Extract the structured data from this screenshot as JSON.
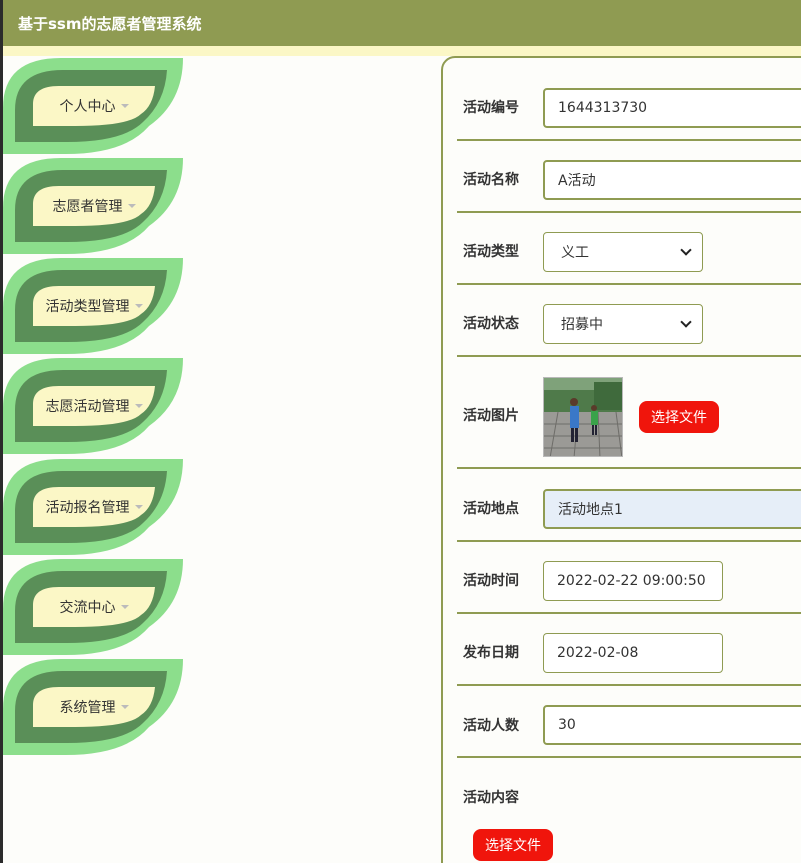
{
  "header": {
    "title": "基于ssm的志愿者管理系统"
  },
  "sidebar": {
    "items": [
      {
        "label": "个人中心"
      },
      {
        "label": "志愿者管理"
      },
      {
        "label": "活动类型管理"
      },
      {
        "label": "志愿活动管理"
      },
      {
        "label": "活动报名管理"
      },
      {
        "label": "交流中心"
      },
      {
        "label": "系统管理"
      }
    ]
  },
  "form": {
    "activity_no": {
      "label": "活动编号",
      "value": "1644313730"
    },
    "activity_name": {
      "label": "活动名称",
      "value": "A活动"
    },
    "activity_type": {
      "label": "活动类型",
      "selected": "义工"
    },
    "activity_status": {
      "label": "活动状态",
      "selected": "招募中"
    },
    "activity_image": {
      "label": "活动图片",
      "button": "选择文件"
    },
    "activity_place": {
      "label": "活动地点",
      "value": "活动地点1"
    },
    "activity_time": {
      "label": "活动时间",
      "value": "2022-02-22 09:00:50"
    },
    "publish_date": {
      "label": "发布日期",
      "value": "2022-02-08"
    },
    "activity_count": {
      "label": "活动人数",
      "value": "30"
    },
    "activity_content": {
      "label": "活动内容",
      "button": "选择文件"
    }
  },
  "colors": {
    "header_bg": "#8f9b52",
    "leaf_outer": "#8cde8c",
    "leaf_inner": "#5a8f58",
    "leaf_label": "#fbf7c6",
    "button_red": "#f0150c"
  }
}
